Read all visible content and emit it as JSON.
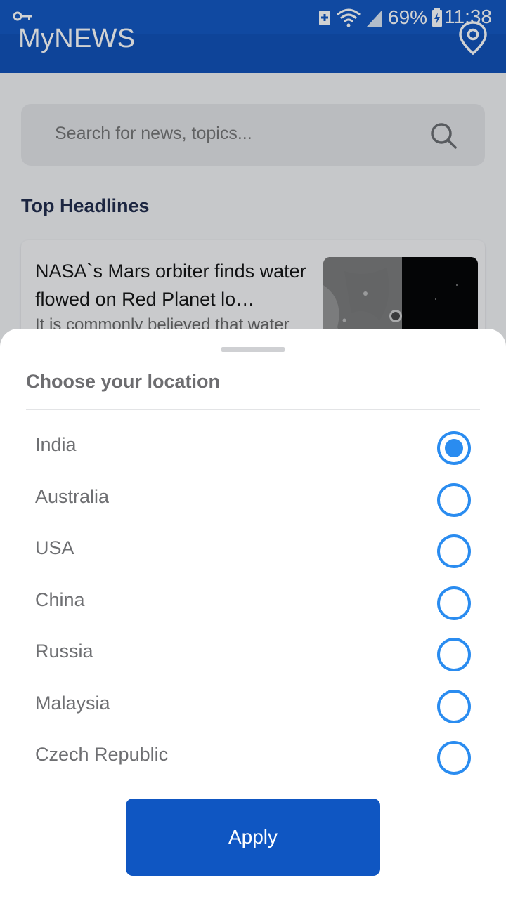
{
  "status_bar": {
    "battery": "69%",
    "time": "11:38"
  },
  "app_bar": {
    "title": "MyNEWS",
    "location_icon": "map-pin-icon"
  },
  "search": {
    "placeholder": "Search for news, topics..."
  },
  "section": {
    "title": "Top Headlines"
  },
  "headline_card": {
    "title": "NASA`s Mars orbiter finds water flowed on Red Planet lo…",
    "description": "It is commonly believed that water"
  },
  "sheet": {
    "title": "Choose your location",
    "options": [
      {
        "label": "India",
        "selected": true
      },
      {
        "label": "Australia",
        "selected": false
      },
      {
        "label": "USA",
        "selected": false
      },
      {
        "label": "China",
        "selected": false
      },
      {
        "label": "Russia",
        "selected": false
      },
      {
        "label": "Malaysia",
        "selected": false
      },
      {
        "label": "Czech Republic",
        "selected": false
      }
    ],
    "apply_label": "Apply"
  },
  "colors": {
    "primary": "#0f56c2",
    "radio": "#2a8cf0"
  }
}
